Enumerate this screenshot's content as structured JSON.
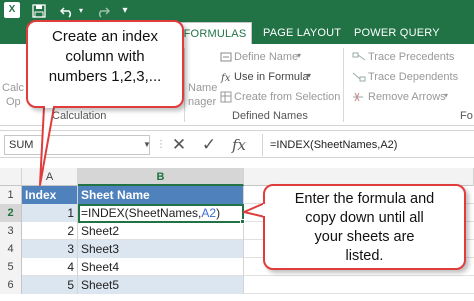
{
  "app": {
    "icon_letter": "X"
  },
  "qat": {
    "save_icon": "save-icon",
    "undo_icon": "undo-icon",
    "redo_icon": "redo-icon",
    "customize_icon": "customize-qat-icon"
  },
  "tabs": {
    "formulas": "FORMULAS",
    "page_layout": "PAGE LAYOUT",
    "power_query": "POWER QUERY"
  },
  "ribbon": {
    "calc_partial": "Calc",
    "calc_partial2": "Op",
    "calculation_label": "Calculation",
    "name_partial1": "Name",
    "name_partial2": "nager",
    "define_name": "Define Name",
    "use_in_formula": "Use in Formula",
    "create_from_selection": "Create from Selection",
    "defined_names_label": "Defined Names",
    "trace_precedents": "Trace Precedents",
    "trace_dependents": "Trace Dependents",
    "remove_arrows": "Remove Arrows",
    "formula_auditing_partial": "Fo"
  },
  "formula_bar": {
    "name_box": "SUM",
    "cancel_glyph": "✕",
    "enter_glyph": "✓",
    "fx_label": "fx",
    "formula": "=INDEX(SheetNames,A2)"
  },
  "grid": {
    "columns": [
      "A",
      "B"
    ],
    "headers": {
      "index": "Index",
      "sheet_name": "Sheet Name"
    },
    "rows": [
      {
        "num": "1"
      },
      {
        "num": "2",
        "index": "1",
        "formula_prefix": "=INDEX(SheetNames,",
        "formula_ref": "A2",
        "formula_suffix": ")"
      },
      {
        "num": "3",
        "index": "2",
        "sheet": "Sheet2"
      },
      {
        "num": "4",
        "index": "3",
        "sheet": "Sheet3"
      },
      {
        "num": "5",
        "index": "4",
        "sheet": "Sheet4"
      },
      {
        "num": "6",
        "index": "5",
        "sheet": "Sheet5"
      }
    ]
  },
  "callouts": {
    "left": [
      "Create an index",
      "column with",
      "numbers 1,2,3,..."
    ],
    "right": [
      "Enter the formula and",
      "copy down until all",
      "your sheets are",
      "listed."
    ]
  },
  "colors": {
    "excel_green": "#217346",
    "header_blue": "#4f81bd",
    "band_blue": "#dce6f1",
    "callout_border": "#e03c3c",
    "ref_blue": "#3b6fd4"
  }
}
